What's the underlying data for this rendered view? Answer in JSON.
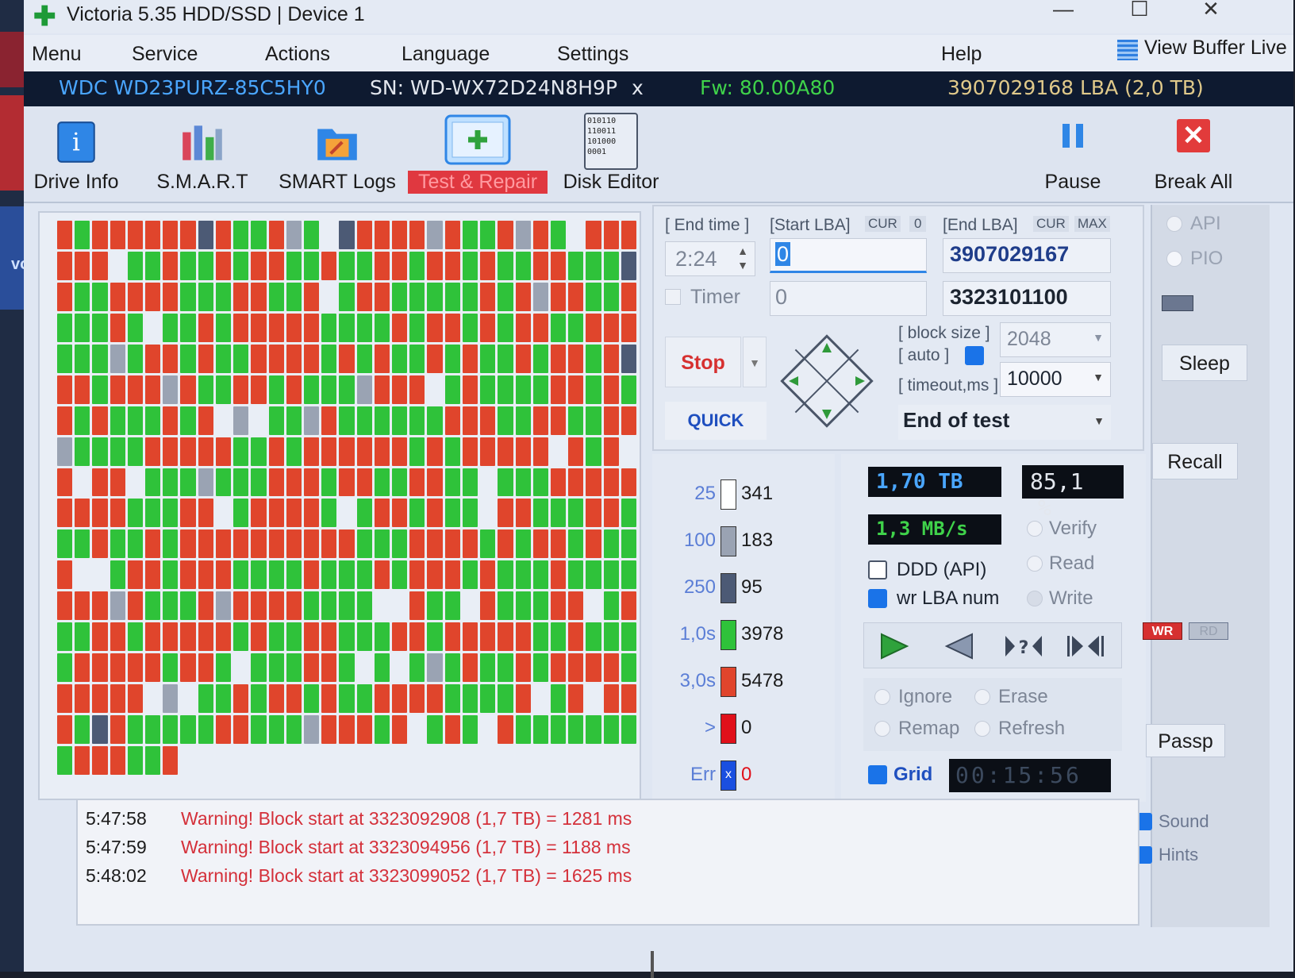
{
  "window": {
    "title": "Victoria 5.35 HDD/SSD | Device 1",
    "controls": {
      "minimize": "—",
      "maximize": "☐",
      "close": "✕"
    }
  },
  "desktop": {
    "side_text": "vo"
  },
  "menu": {
    "items": [
      "Menu",
      "Service",
      "Actions",
      "Language",
      "Settings",
      "Help"
    ],
    "view_buffer_live": "View Buffer Live"
  },
  "drive": {
    "model": "WDC WD23PURZ-85C5HY0",
    "serial": "SN: WD-WX72D24N8H9P",
    "close": "x",
    "firmware": "Fw: 80.00A80",
    "capacity": "3907029168 LBA (2,0 TB)"
  },
  "toolbar": {
    "drive_info": "Drive Info",
    "smart": "S.M.A.R.T",
    "smart_logs": "SMART Logs",
    "test_repair": "Test & Repair",
    "disk_editor": "Disk Editor",
    "disk_editor_icon_text": "010110\n110011\n101000\n0001",
    "pause": "Pause",
    "break_all": "Break All"
  },
  "scan": {
    "end_time_label": "[ End time ]",
    "end_time_value": "2:24",
    "start_lba_label": "[Start LBA]",
    "start_cur": "CUR",
    "start_zero": "0",
    "start_lba_value": "0",
    "end_lba_label": "[End LBA]",
    "end_cur": "CUR",
    "end_max": "MAX",
    "end_lba_value": "3907029167",
    "timer_label": "Timer",
    "timer_value": "0",
    "current_lba": "3323101100",
    "stop_label": "Stop",
    "quick_label": "QUICK",
    "block_size_label": "[ block size ]",
    "block_size_value": "2048",
    "auto_label": "[ auto ]",
    "timeout_label": "[ timeout,ms ]",
    "timeout_value": "10000",
    "end_action": "End of test"
  },
  "stats": [
    {
      "key": "25",
      "value": "341",
      "color": "#ffffff"
    },
    {
      "key": "100",
      "value": "183",
      "color": "#9aa3b3"
    },
    {
      "key": "250",
      "value": "95",
      "color": "#4c5a75"
    },
    {
      "key": "1,0s",
      "value": "3978",
      "color": "#2fc23a"
    },
    {
      "key": "3,0s",
      "value": "5478",
      "color": "#e0452c"
    },
    {
      "key": ">",
      "value": "0",
      "color": "#e0101a"
    },
    {
      "key": "Err",
      "value": "0",
      "color": "#1a4fe0",
      "mark": "x"
    }
  ],
  "progress": {
    "position": "1,70 TB",
    "percent": "85,1",
    "percent_unit": "%",
    "speed": "1,3 MB/s",
    "verify": "Verify",
    "read": "Read",
    "write": "Write",
    "ddd_api": "DDD (API)",
    "wr_lba_num": "wr LBA num",
    "ignore": "Ignore",
    "erase": "Erase",
    "remap": "Remap",
    "refresh": "Refresh",
    "grid": "Grid",
    "elapsed": "00:15:56"
  },
  "side": {
    "api": "API",
    "pio": "PIO",
    "sleep": "Sleep",
    "recall": "Recall",
    "wr": "WR",
    "rd": "RD",
    "passp": "Passp",
    "sound": "Sound",
    "hints": "Hints"
  },
  "log": [
    {
      "time": "5:47:58",
      "message": "Warning! Block start at 3323092908 (1,7 TB)  = 1281 ms"
    },
    {
      "time": "5:47:59",
      "message": "Warning! Block start at 3323094956 (1,7 TB)  = 1188 ms"
    },
    {
      "time": "5:48:02",
      "message": "Warning! Block start at 3323099052 (1,7 TB)  = 1625 ms"
    }
  ],
  "colors": {
    "ok_block": "#2fc23a",
    "slow_block": "#e0452c",
    "empty_block": "#e9eef6",
    "gray_block": "#9aa3b3",
    "dark_block": "#4c5a75",
    "accent": "#1a73e8"
  }
}
